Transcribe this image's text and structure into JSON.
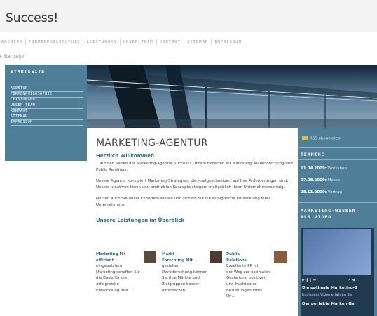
{
  "site": {
    "title": "Success!"
  },
  "topnav": [
    "AGENTUR",
    "FIRMENPHILOSOPHIE",
    "LEISTUNGEN",
    "UNSER TEAM",
    "KONTAKT",
    "SITEMAP",
    "IMPRESSUM"
  ],
  "breadcrumb": {
    "label": "Startseite"
  },
  "sidebar": {
    "heading": "STARTSEITE",
    "items": [
      "AGENTUR",
      "FIRMENPHILOSOPHIE",
      "LEISTUNGEN",
      "UNSER TEAM",
      "KONTAKT",
      "SITEMAP",
      "IMPRESSUM"
    ]
  },
  "main": {
    "heading": "MARKETING-AGENTUR",
    "welcome_title": "Herzlich Willkommen",
    "welcome_text": "...auf den Seiten der Marketing-Agentur Success! - Ihrem Experten für Marketing, Marktforschung und Public Relations.",
    "para2": "Unsere Agentur konzipiert Marketing-Strategien, die maßgeschneidert auf Ihre Anforderungen sind. Unsere kreativen Ideen und profitablen Konzepte steigern maßgeblich Ihren Unternehmenserfolg.",
    "para3": "Nutzen auch Sie unser Experten-Wissen und sichern Sie die erfolgreiche Entwicklung Ihres Unternehmens.",
    "services_heading": "Unsere Leistungen im Überblick"
  },
  "services": [
    {
      "title": "Marketing",
      "lines": [
        "Mit",
        "effizient",
        "eingesetztem",
        "Marketing schaffen Sie",
        "die Basis für die",
        "erfolgreiche",
        "Entwicklung Ihre..."
      ]
    },
    {
      "title": "Markt-",
      "lines": [
        "Forschung Mit",
        "gezielter",
        "Marktforschung können",
        "Sie Ihre Märkte und",
        "Zielgruppen besser",
        "einschätzen."
      ]
    },
    {
      "title": "Public",
      "lines": [
        "Relations",
        "Exzellente PR ist",
        "der Weg zur optimalen",
        "Gestaltung positiver",
        "und fruchtbarer",
        "Beziehungen Ihres",
        "Un..."
      ]
    }
  ],
  "right": {
    "rss": "RSS abonnieren",
    "termine_heading": "TERMINE",
    "events": [
      {
        "date": "11.04.2009:",
        "label": "Workshop"
      },
      {
        "date": "07.08.2009:",
        "label": "Messe"
      },
      {
        "date": "28.11.2009:",
        "label": "Vortrag"
      }
    ],
    "video_heading_1": "MARKETING-WISSEN",
    "video_heading_2": "ALS VIDEO",
    "video_caption_1": "Die optimale Marketing-S",
    "video_caption_2": "In diesem Video erfahren Sie",
    "video_caption_3": "Der perfekte Marken-Bar"
  }
}
